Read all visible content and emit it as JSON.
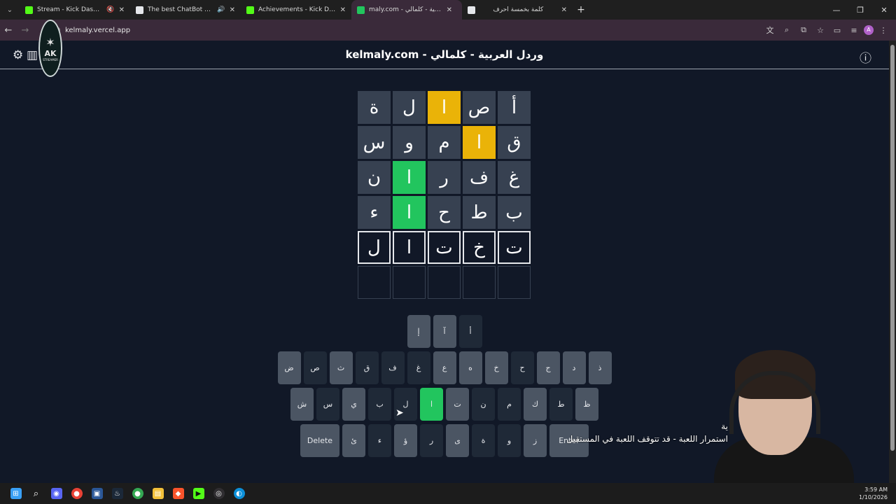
{
  "browser": {
    "tabs": [
      {
        "title": "Stream - Kick Dashboard",
        "favicon": "kick-icon",
        "color": "#53fc18",
        "muted": true
      },
      {
        "title": "The best ChatBot and Widg",
        "favicon": "chatbot-icon",
        "color": "#e5e7eb",
        "sound": true
      },
      {
        "title": "Achievements - Kick Dashboard",
        "favicon": "kick-icon",
        "color": "#53fc18"
      },
      {
        "title": "maly.com - وردل العربية - كلمالي",
        "favicon": "globe-icon",
        "color": "#22c55e",
        "active": true
      },
      {
        "title": "كلمة بخمسة أحرف",
        "favicon": "chatgpt-icon",
        "color": "#e5e7eb"
      }
    ],
    "new_tab": "+",
    "url": "kelmaly.vercel.app"
  },
  "page": {
    "title": "kelmaly.com - وردل العربية - كلمالي",
    "logo_text": "AK",
    "logo_sub": "STREAMER"
  },
  "board": [
    [
      {
        "l": "ة",
        "s": "absent"
      },
      {
        "l": "ل",
        "s": "absent"
      },
      {
        "l": "ا",
        "s": "present"
      },
      {
        "l": "ص",
        "s": "absent"
      },
      {
        "l": "أ",
        "s": "absent"
      }
    ],
    [
      {
        "l": "س",
        "s": "absent"
      },
      {
        "l": "و",
        "s": "absent"
      },
      {
        "l": "م",
        "s": "absent"
      },
      {
        "l": "ا",
        "s": "present"
      },
      {
        "l": "ق",
        "s": "absent"
      }
    ],
    [
      {
        "l": "ن",
        "s": "absent"
      },
      {
        "l": "ا",
        "s": "correct"
      },
      {
        "l": "ر",
        "s": "absent"
      },
      {
        "l": "ف",
        "s": "absent"
      },
      {
        "l": "غ",
        "s": "absent"
      }
    ],
    [
      {
        "l": "ء",
        "s": "absent"
      },
      {
        "l": "ا",
        "s": "correct"
      },
      {
        "l": "ح",
        "s": "absent"
      },
      {
        "l": "ط",
        "s": "absent"
      },
      {
        "l": "ب",
        "s": "absent"
      }
    ],
    [
      {
        "l": "ل",
        "s": "typed"
      },
      {
        "l": "ا",
        "s": "typed"
      },
      {
        "l": "ت",
        "s": "typed"
      },
      {
        "l": "خ",
        "s": "typed"
      },
      {
        "l": "ت",
        "s": "typed"
      }
    ],
    [
      {
        "l": "",
        "s": "empty"
      },
      {
        "l": "",
        "s": "empty"
      },
      {
        "l": "",
        "s": "empty"
      },
      {
        "l": "",
        "s": "empty"
      },
      {
        "l": "",
        "s": "empty"
      }
    ]
  ],
  "keyboard": [
    [
      {
        "k": "إ",
        "s": "unused"
      },
      {
        "k": "آ",
        "s": "unused"
      },
      {
        "k": "أ",
        "s": "absent"
      }
    ],
    [
      {
        "k": "ض",
        "s": "unused"
      },
      {
        "k": "ص",
        "s": "absent"
      },
      {
        "k": "ث",
        "s": "unused"
      },
      {
        "k": "ق",
        "s": "absent"
      },
      {
        "k": "ف",
        "s": "absent"
      },
      {
        "k": "غ",
        "s": "absent"
      },
      {
        "k": "ع",
        "s": "unused"
      },
      {
        "k": "ه",
        "s": "unused"
      },
      {
        "k": "خ",
        "s": "unused"
      },
      {
        "k": "ح",
        "s": "absent"
      },
      {
        "k": "ج",
        "s": "unused"
      },
      {
        "k": "د",
        "s": "unused"
      },
      {
        "k": "ذ",
        "s": "unused"
      }
    ],
    [
      {
        "k": "ش",
        "s": "unused"
      },
      {
        "k": "س",
        "s": "absent"
      },
      {
        "k": "ي",
        "s": "unused"
      },
      {
        "k": "ب",
        "s": "absent"
      },
      {
        "k": "ل",
        "s": "absent"
      },
      {
        "k": "ا",
        "s": "correct"
      },
      {
        "k": "ت",
        "s": "unused"
      },
      {
        "k": "ن",
        "s": "absent"
      },
      {
        "k": "م",
        "s": "absent"
      },
      {
        "k": "ك",
        "s": "unused"
      },
      {
        "k": "ط",
        "s": "absent"
      },
      {
        "k": "ظ",
        "s": "unused"
      }
    ],
    [
      {
        "k": "Delete",
        "s": "unused",
        "wide": true
      },
      {
        "k": "ئ",
        "s": "unused"
      },
      {
        "k": "ء",
        "s": "absent"
      },
      {
        "k": "ؤ",
        "s": "unused"
      },
      {
        "k": "ر",
        "s": "absent"
      },
      {
        "k": "ى",
        "s": "unused"
      },
      {
        "k": "ة",
        "s": "absent"
      },
      {
        "k": "و",
        "s": "absent"
      },
      {
        "k": "ز",
        "s": "unused"
      },
      {
        "k": "Enter",
        "s": "unused",
        "wide": true
      }
    ]
  ],
  "overlay": {
    "subtitle_line1": "ية",
    "subtitle_line2": "استمرار اللعبة - قد تتوقف اللعبة في المستقبل"
  },
  "taskbar": {
    "time": "3:59 AM",
    "date": "1/10/2026"
  }
}
